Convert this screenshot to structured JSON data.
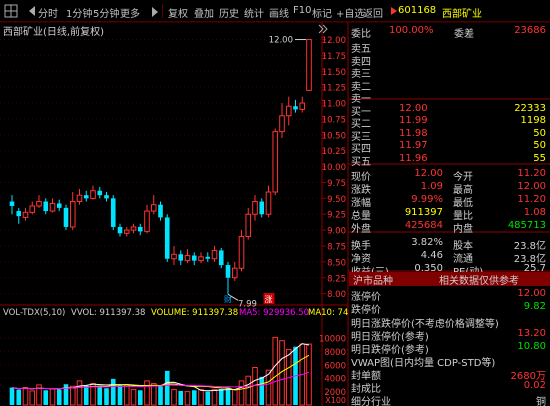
{
  "toolbar": {
    "items": [
      "分时",
      "1分钟",
      "5分钟",
      "更多",
      "复权",
      "叠加",
      "历史",
      "统计",
      "画线",
      "F10",
      "标记",
      "+自选",
      "返回"
    ],
    "stock_code": "601168",
    "stock_name": "西部矿业"
  },
  "chart": {
    "title": "西部矿业(日线,前复权)",
    "high_label": "12.00",
    "low_label": "7.99",
    "marker_cai": "财",
    "marker_zhang": "涨",
    "price_ticks": [
      "12.00",
      "11.75",
      "11.50",
      "11.25",
      "11.00",
      "10.75",
      "10.50",
      "10.25",
      "10.00",
      "9.75",
      "9.50",
      "9.25",
      "9.00",
      "8.75",
      "8.50",
      "8.25",
      "8.00"
    ],
    "vol_ticks": [
      "10000",
      "8000",
      "6000",
      "4000",
      "2000"
    ],
    "vol_unit": "X100",
    "vol_header": {
      "name": "VOL-TDX(5,10)",
      "vvol": "VVOL: 911397.38",
      "volume": "VOLUME: 911397.38",
      "ma5": "MA5: 929936.50",
      "ma10": "MA10: 749"
    }
  },
  "chart_data": {
    "type": "candlestick",
    "title": "西部矿业(日线,前复权)",
    "ylim": [
      7.9,
      12.15
    ],
    "candles": [
      {
        "o": 9.45,
        "c": 9.38,
        "h": 9.55,
        "l": 9.25
      },
      {
        "o": 9.3,
        "c": 9.22,
        "h": 9.35,
        "l": 9.1
      },
      {
        "o": 9.2,
        "c": 9.28,
        "h": 9.35,
        "l": 9.15
      },
      {
        "o": 9.28,
        "c": 9.38,
        "h": 9.45,
        "l": 9.25
      },
      {
        "o": 9.38,
        "c": 9.45,
        "h": 9.55,
        "l": 9.35
      },
      {
        "o": 9.45,
        "c": 9.3,
        "h": 9.5,
        "l": 9.25
      },
      {
        "o": 9.3,
        "c": 9.42,
        "h": 9.5,
        "l": 9.28
      },
      {
        "o": 9.42,
        "c": 9.35,
        "h": 9.48,
        "l": 9.3
      },
      {
        "o": 9.35,
        "c": 9.05,
        "h": 9.4,
        "l": 9.0
      },
      {
        "o": 9.05,
        "c": 9.45,
        "h": 9.6,
        "l": 9.0
      },
      {
        "o": 9.45,
        "c": 9.55,
        "h": 9.65,
        "l": 9.4
      },
      {
        "o": 9.55,
        "c": 9.5,
        "h": 9.62,
        "l": 9.45
      },
      {
        "o": 9.5,
        "c": 9.62,
        "h": 9.7,
        "l": 9.48
      },
      {
        "o": 9.62,
        "c": 9.55,
        "h": 9.68,
        "l": 9.5
      },
      {
        "o": 9.55,
        "c": 9.5,
        "h": 9.6,
        "l": 9.45
      },
      {
        "o": 9.5,
        "c": 9.05,
        "h": 9.55,
        "l": 9.0
      },
      {
        "o": 9.05,
        "c": 8.95,
        "h": 9.1,
        "l": 8.9
      },
      {
        "o": 8.95,
        "c": 9.0,
        "h": 9.05,
        "l": 8.9
      },
      {
        "o": 9.0,
        "c": 9.05,
        "h": 9.1,
        "l": 8.95
      },
      {
        "o": 9.05,
        "c": 8.98,
        "h": 9.1,
        "l": 8.92
      },
      {
        "o": 8.98,
        "c": 9.3,
        "h": 9.4,
        "l": 8.95
      },
      {
        "o": 9.3,
        "c": 9.4,
        "h": 9.55,
        "l": 9.25
      },
      {
        "o": 9.4,
        "c": 9.2,
        "h": 9.45,
        "l": 9.15
      },
      {
        "o": 9.2,
        "c": 8.55,
        "h": 9.25,
        "l": 8.5
      },
      {
        "o": 8.55,
        "c": 8.62,
        "h": 8.75,
        "l": 8.45
      },
      {
        "o": 8.62,
        "c": 8.52,
        "h": 8.68,
        "l": 8.45
      },
      {
        "o": 8.52,
        "c": 8.6,
        "h": 8.7,
        "l": 8.48
      },
      {
        "o": 8.6,
        "c": 8.52,
        "h": 8.65,
        "l": 8.45
      },
      {
        "o": 8.52,
        "c": 8.58,
        "h": 8.65,
        "l": 8.48
      },
      {
        "o": 8.58,
        "c": 8.55,
        "h": 8.65,
        "l": 8.5
      },
      {
        "o": 8.55,
        "c": 8.68,
        "h": 8.75,
        "l": 8.5
      },
      {
        "o": 8.68,
        "c": 8.45,
        "h": 8.72,
        "l": 8.4
      },
      {
        "o": 8.45,
        "c": 8.25,
        "h": 8.5,
        "l": 7.99
      },
      {
        "o": 8.25,
        "c": 8.4,
        "h": 8.5,
        "l": 8.2
      },
      {
        "o": 8.4,
        "c": 8.9,
        "h": 9.0,
        "l": 8.35
      },
      {
        "o": 8.9,
        "c": 9.25,
        "h": 9.35,
        "l": 8.85
      },
      {
        "o": 9.25,
        "c": 9.45,
        "h": 9.55,
        "l": 9.15
      },
      {
        "o": 9.45,
        "c": 9.25,
        "h": 9.5,
        "l": 9.2
      },
      {
        "o": 9.25,
        "c": 9.6,
        "h": 9.7,
        "l": 9.2
      },
      {
        "o": 9.6,
        "c": 10.55,
        "h": 10.6,
        "l": 9.55
      },
      {
        "o": 10.55,
        "c": 10.8,
        "h": 11.0,
        "l": 10.45
      },
      {
        "o": 10.8,
        "c": 10.95,
        "h": 11.1,
        "l": 10.65
      },
      {
        "o": 10.95,
        "c": 10.9,
        "h": 11.05,
        "l": 10.85
      },
      {
        "o": 10.9,
        "c": 11.0,
        "h": 11.1,
        "l": 10.85
      },
      {
        "o": 11.2,
        "c": 12.0,
        "h": 12.0,
        "l": 11.2
      }
    ],
    "volumes": [
      2600,
      2300,
      2600,
      2100,
      3000,
      2200,
      2400,
      2300,
      3100,
      2800,
      3600,
      2900,
      3200,
      2700,
      2500,
      3900,
      2900,
      3000,
      2300,
      2200,
      3600,
      3200,
      2800,
      5100,
      2300,
      2100,
      2000,
      2200,
      2300,
      2000,
      2300,
      2400,
      2600,
      2300,
      3600,
      4300,
      5600,
      4200,
      5200,
      10100,
      9600,
      8300,
      8700,
      9100,
      9100
    ],
    "ma_lines": [
      {
        "name": "MA5",
        "color": "#ffffff"
      },
      {
        "name": "MA10",
        "color": "#ffff00"
      },
      {
        "name": "MA20",
        "color": "#ff00ff"
      }
    ]
  },
  "orderbook": {
    "weibi_label": "委比",
    "weibi": "100.00%",
    "weicha_label": "委差",
    "weicha": "23686",
    "sells": [
      {
        "label": "卖五",
        "price": "",
        "vol": ""
      },
      {
        "label": "卖四",
        "price": "",
        "vol": ""
      },
      {
        "label": "卖三",
        "price": "",
        "vol": ""
      },
      {
        "label": "卖二",
        "price": "",
        "vol": ""
      },
      {
        "label": "卖一",
        "price": "",
        "vol": ""
      }
    ],
    "buys": [
      {
        "label": "买一",
        "price": "12.00",
        "vol": "22333"
      },
      {
        "label": "买二",
        "price": "11.99",
        "vol": "1198"
      },
      {
        "label": "买三",
        "price": "11.98",
        "vol": "50"
      },
      {
        "label": "买四",
        "price": "11.97",
        "vol": "50"
      },
      {
        "label": "买五",
        "price": "11.96",
        "vol": "55"
      }
    ]
  },
  "quote": {
    "rows": [
      {
        "l1": "现价",
        "v1": "12.00",
        "c1": "red",
        "l2": "今开",
        "v2": "11.20",
        "c2": "red"
      },
      {
        "l1": "涨跌",
        "v1": "1.09",
        "c1": "red",
        "l2": "最高",
        "v2": "12.00",
        "c2": "red"
      },
      {
        "l1": "涨幅",
        "v1": "9.99%",
        "c1": "red",
        "l2": "最低",
        "v2": "11.20",
        "c2": "red"
      },
      {
        "l1": "总量",
        "v1": "911397",
        "c1": "yellow",
        "l2": "量比",
        "v2": "1.08",
        "c2": "red"
      },
      {
        "l1": "外盘",
        "v1": "425684",
        "c1": "red",
        "l2": "内盘",
        "v2": "485713",
        "c2": "green"
      },
      {
        "l1": "换手",
        "v1": "3.82%",
        "c1": "white",
        "l2": "股本",
        "v2": "23.8亿",
        "c2": "white"
      },
      {
        "l1": "净资",
        "v1": "4.46",
        "c1": "white",
        "l2": "流通",
        "v2": "23.8亿",
        "c2": "white"
      },
      {
        "l1": "收益(三)",
        "v1": "0.350",
        "c1": "white",
        "l2": "PE(动)",
        "v2": "25.7",
        "c2": "white"
      }
    ]
  },
  "bottom": {
    "tab1": "沪市品种",
    "tab2": "相关数据仅供参考",
    "zhangting_label": "涨停价",
    "zhangting": "12.00",
    "dieting_label": "跌停价",
    "dieting": "9.82",
    "mingri_note": "明日涨跌停价(不考虑价格调整等)",
    "mingri_zt_label": "明日涨停价(参考)",
    "mingri_zt": "13.20",
    "mingri_dt_label": "明日跌停价(参考)",
    "mingri_dt": "10.80",
    "vwap": "VWAP图(日内均量 CDP-STD等)",
    "fengdan_label": "封单额",
    "fengdan": "2680万",
    "fengcheng_label": "封成比",
    "fengcheng": "0.02",
    "industry_label": "细分行业",
    "industry": "铜"
  }
}
